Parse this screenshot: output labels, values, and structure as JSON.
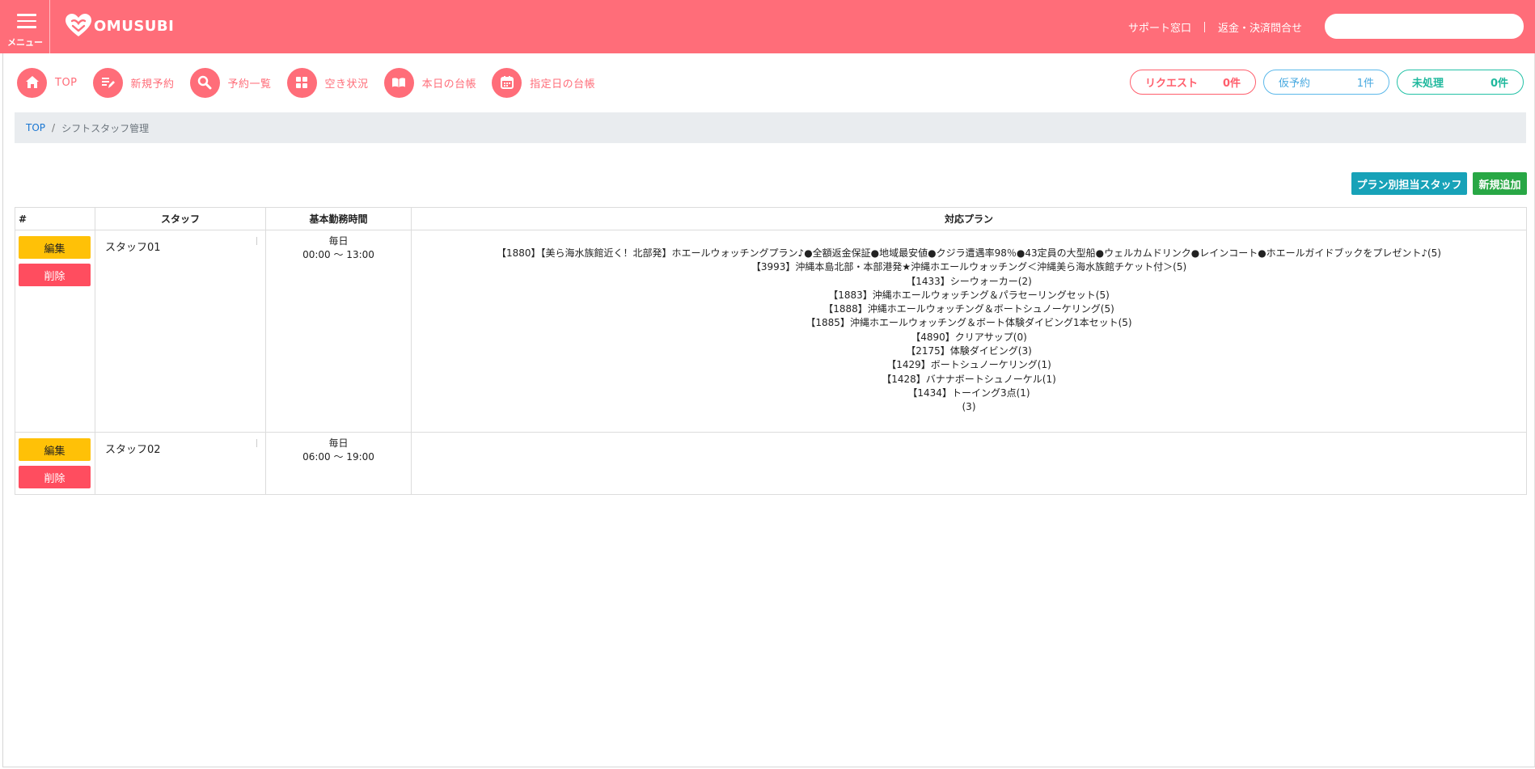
{
  "header": {
    "menu_label": "メニュー",
    "logo_text": "OMUSUBI",
    "links": [
      "サポート窓口",
      "返金・決済問合せ"
    ],
    "search_placeholder": ""
  },
  "nav": [
    {
      "label": "TOP",
      "icon": "home-icon"
    },
    {
      "label": "新規予約",
      "icon": "edit-icon"
    },
    {
      "label": "予約一覧",
      "icon": "search-icon"
    },
    {
      "label": "空き状況",
      "icon": "grid-icon"
    },
    {
      "label": "本日の台帳",
      "icon": "book-icon"
    },
    {
      "label": "指定日の台帳",
      "icon": "calendar-icon"
    }
  ],
  "status_pills": {
    "request": {
      "label": "リクエスト",
      "count": "0件"
    },
    "tentative": {
      "label": "仮予約",
      "count": "1件"
    },
    "unprocessed": {
      "label": "未処理",
      "count": "0件"
    }
  },
  "breadcrumb": {
    "home": "TOP",
    "separator": "/",
    "current": "シフトスタッフ管理"
  },
  "actions": {
    "plan_staff": "プラン別担当スタッフ",
    "add_new": "新規追加"
  },
  "table": {
    "headers": [
      "#",
      "スタッフ",
      "基本勤務時間",
      "対応プラン"
    ],
    "edit_label": "編集",
    "delete_label": "削除",
    "rows": [
      {
        "staff": "スタッフ01",
        "day": "毎日",
        "hours": "00:00 ～ 13:00",
        "plans": [
          "【1880】【美ら海水族館近く！北部発】ホエールウォッチングプラン♪●全額返金保証●地域最安値●クジラ遭遇率98％●43定員の大型船●ウェルカムドリンク●レインコート●ホエールガイドブックをプレゼント♪(5)",
          "【3993】沖縄本島北部・本部港発★沖縄ホエールウォッチング＜沖縄美ら海水族館チケット付＞(5)",
          "【1433】シーウォーカー(2)",
          "【1883】沖縄ホエールウォッチング＆パラセーリングセット(5)",
          "【1888】沖縄ホエールウォッチング＆ボートシュノーケリング(5)",
          "【1885】沖縄ホエールウォッチング＆ボート体験ダイビング1本セット(5)",
          "【4890】クリアサップ(0)",
          "【2175】体験ダイビング(3)",
          "【1429】ボートシュノーケリング(1)",
          "【1428】バナナボートシュノーケル(1)",
          "【1434】トーイング3点(1)",
          "(3)"
        ]
      },
      {
        "staff": "スタッフ02",
        "day": "毎日",
        "hours": "06:00 ～ 19:00",
        "plans": []
      }
    ]
  },
  "colors": {
    "brand": "#ff6d79",
    "request": "#ff5e6c",
    "tentative": "#48a9e0",
    "unprocessed": "#1fb89d",
    "edit": "#ffc107",
    "delete": "#ff4d5f",
    "plan_button": "#17a2b8",
    "new_button": "#28a745"
  }
}
